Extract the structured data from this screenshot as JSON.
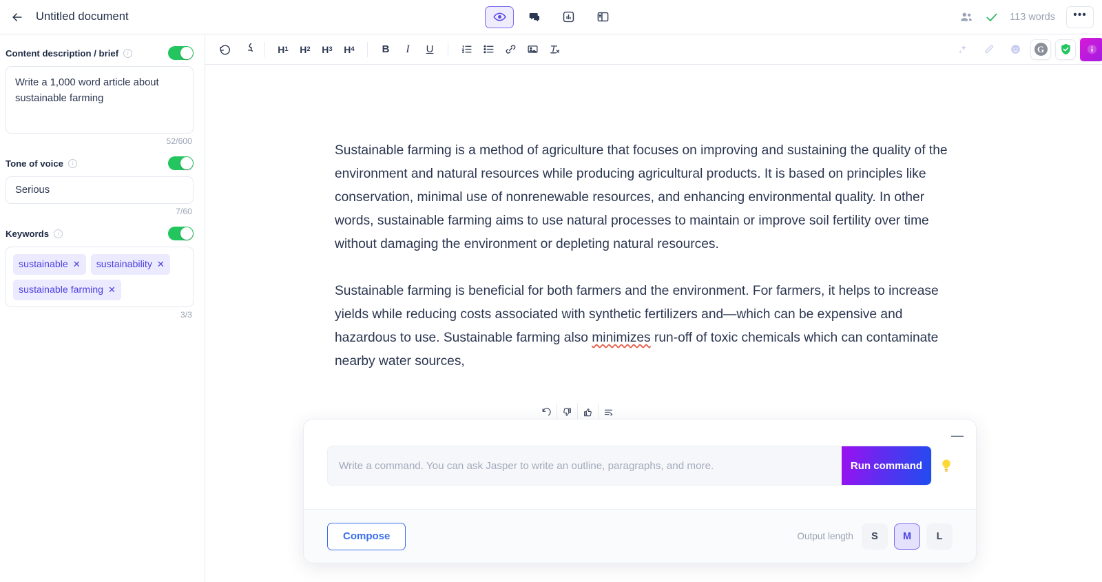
{
  "topbar": {
    "back_icon": "arrow-left-icon",
    "doc_title": "Untitled document",
    "view_modes": [
      {
        "name": "preview",
        "icon": "eye-icon",
        "active": true
      },
      {
        "name": "comments",
        "icon": "chat-bubble-icon",
        "active": false
      },
      {
        "name": "analytics",
        "icon": "chart-icon",
        "active": false
      },
      {
        "name": "layout",
        "icon": "panel-icon",
        "active": false
      }
    ],
    "people_icon": "people-icon",
    "saved_icon": "check-icon",
    "word_count": "113 words",
    "more_label": "•••"
  },
  "sidebar": {
    "fields": [
      {
        "label": "Content description / brief",
        "info_icon": "info-icon",
        "toggle_on": true,
        "value": "Write a 1,000 word article about sustainable farming",
        "counter": "52/600"
      },
      {
        "label": "Tone of voice",
        "info_icon": "info-icon",
        "toggle_on": true,
        "value": "Serious",
        "counter": "7/60"
      },
      {
        "label": "Keywords",
        "info_icon": "info-icon",
        "toggle_on": true,
        "counter": "3/3",
        "chips": [
          "sustainable",
          "sustainability",
          "sustainable farming"
        ]
      }
    ]
  },
  "toolbar": {
    "undo": "undo-icon",
    "redo": "redo-icon",
    "headings": [
      "H1",
      "H2",
      "H3",
      "H4"
    ],
    "bold": "B",
    "italic": "I",
    "underline": "U",
    "ordered_list": "ordered-list-icon",
    "bullet_list": "bullet-list-icon",
    "link": "link-icon",
    "image": "image-icon",
    "clear_format": "clear-format-icon",
    "right_icons": [
      {
        "name": "sparkle-icon"
      },
      {
        "name": "pencil-icon"
      },
      {
        "name": "emoji-icon"
      }
    ],
    "grammarly_label": "G",
    "shield_icon": "shield-check-icon",
    "info_badge_icon": "info-badge-icon"
  },
  "document": {
    "paragraphs": [
      {
        "before": "Sustainable farming is a method of agriculture that focuses on improving and sustaining the quality of the environment and natural resources while producing agricultural products. It is based on principles like conservation, minimal use of nonrenewable resources, and enhancing environmental quality. In other words, sustainable farming aims to use natural processes to maintain or improve soil fertility over time without damaging the environment or depleting natural resources.",
        "misspelled": "",
        "after": ""
      },
      {
        "before": "Sustainable farming is beneficial for both farmers and the environment. For farmers, it helps to increase yields while reducing costs associated with synthetic fertilizers and—which can be expensive and hazardous to use. Sustainable farming also ",
        "misspelled": "minimizes",
        "after": " run-off of toxic chemicals which can contaminate nearby water sources,"
      }
    ]
  },
  "feedback": {
    "buttons": [
      {
        "name": "regenerate-icon"
      },
      {
        "name": "thumbs-down-icon"
      },
      {
        "name": "thumbs-up-icon"
      },
      {
        "name": "options-list-icon"
      }
    ]
  },
  "command_panel": {
    "minimize_label": "—",
    "input_value": "",
    "input_placeholder": "Write a command. You can ask Jasper to write an outline, paragraphs, and more.",
    "run_label": "Run command",
    "bulb_icon": "lightbulb-icon",
    "compose_label": "Compose",
    "output_length_label": "Output length",
    "lengths": [
      {
        "label": "S",
        "active": false
      },
      {
        "label": "M",
        "active": true
      },
      {
        "label": "L",
        "active": false
      }
    ]
  },
  "colors": {
    "accent_purple": "#4a41e0",
    "accent_blue": "#3b6ef0",
    "toggle_green": "#22c55e",
    "text_dark": "#2b3650",
    "muted": "#9aa3b4"
  }
}
